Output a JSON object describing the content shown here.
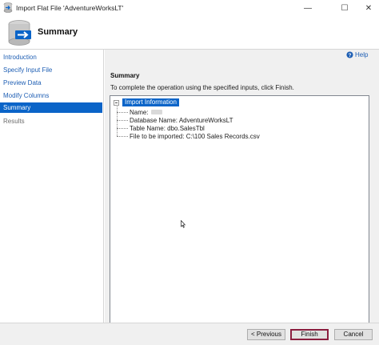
{
  "window": {
    "title": "Import Flat File 'AdventureWorksLT'",
    "minimize_glyph": "—",
    "maximize_glyph": "☐",
    "close_glyph": "✕"
  },
  "header": {
    "title": "Summary",
    "icon": "database-import-icon"
  },
  "sidebar": {
    "items": [
      {
        "label": "Introduction",
        "state": "link"
      },
      {
        "label": "Specify Input File",
        "state": "link"
      },
      {
        "label": "Preview Data",
        "state": "link"
      },
      {
        "label": "Modify Columns",
        "state": "link"
      },
      {
        "label": "Summary",
        "state": "active"
      },
      {
        "label": "Results",
        "state": "disabled"
      }
    ]
  },
  "content": {
    "help_label": "Help",
    "section_title": "Summary",
    "instructions": "To complete the operation using the specified inputs, click Finish.",
    "tree": {
      "root_label": "Import Information",
      "children": [
        {
          "label": "Name:"
        },
        {
          "label": "Database Name: AdventureWorksLT"
        },
        {
          "label": "Table Name: dbo.SalesTbl"
        },
        {
          "label": "File to be imported: C:\\100 Sales Records.csv"
        }
      ]
    }
  },
  "footer": {
    "previous_label": "< Previous",
    "finish_label": "Finish",
    "cancel_label": "Cancel"
  },
  "colors": {
    "accent": "#0a64c8",
    "link": "#1f5fb4",
    "finish_border": "#8b1e3f"
  }
}
